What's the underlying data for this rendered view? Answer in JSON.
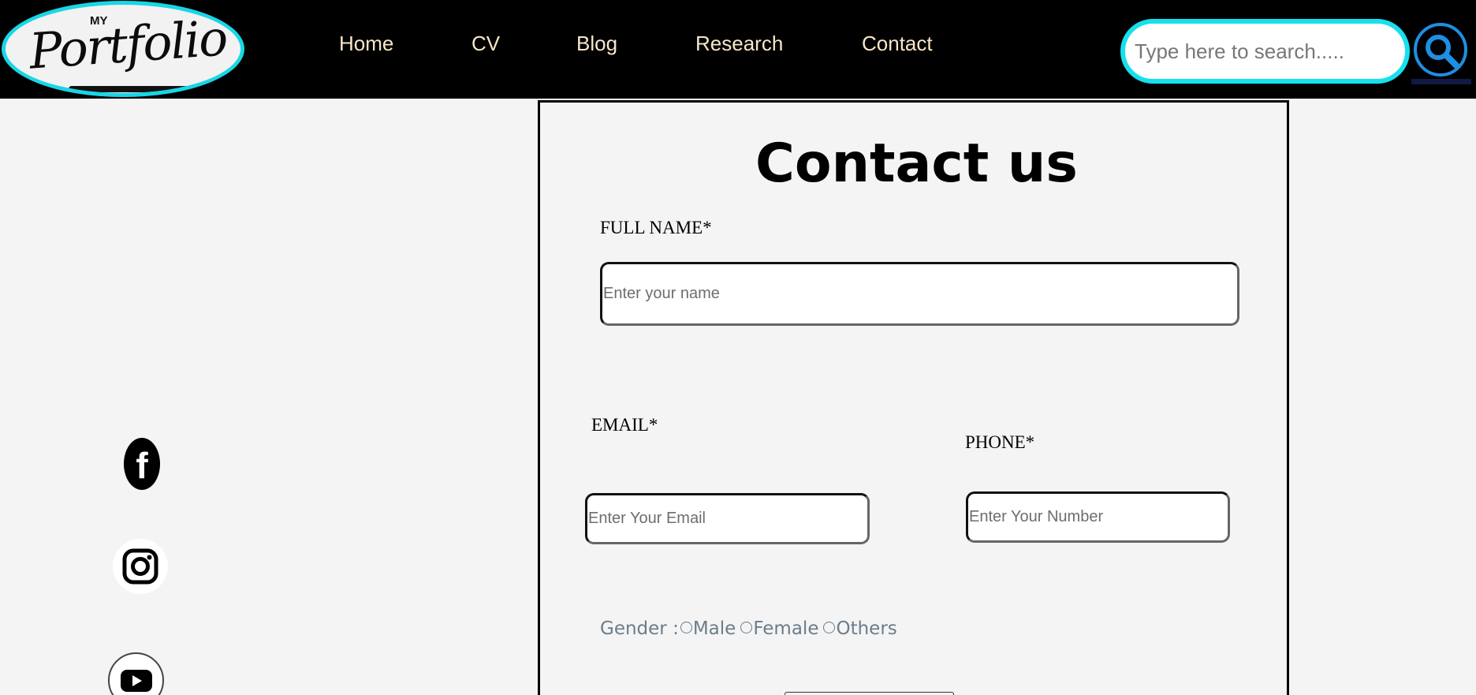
{
  "header": {
    "logo": {
      "small_text": "MY",
      "word": "Portfolio"
    },
    "nav": [
      {
        "label": "Home"
      },
      {
        "label": "CV"
      },
      {
        "label": "Blog"
      },
      {
        "label": "Research"
      },
      {
        "label": "Contact"
      }
    ],
    "search": {
      "placeholder": "Type here to search.....",
      "icon": "search-icon"
    }
  },
  "social": [
    {
      "icon": "facebook-icon",
      "glyph": "f"
    },
    {
      "icon": "instagram-icon"
    },
    {
      "icon": "youtube-icon"
    }
  ],
  "form": {
    "title": "Contact us",
    "full_name": {
      "label": "FULL NAME*",
      "placeholder": "Enter your name"
    },
    "email": {
      "label": "EMAIL*",
      "placeholder": "Enter Your Email"
    },
    "phone": {
      "label": "PHONE*",
      "placeholder": "Enter Your Number"
    },
    "gender": {
      "label": "Gender :",
      "options": [
        "Male",
        "Female",
        "Others"
      ]
    }
  },
  "colors": {
    "header_bg": "#000000",
    "accent_cyan": "#16e0ee",
    "nav_text": "#f7e6c8",
    "search_button_ring": "#1e8fe3",
    "page_bg": "#f4f4f4"
  }
}
